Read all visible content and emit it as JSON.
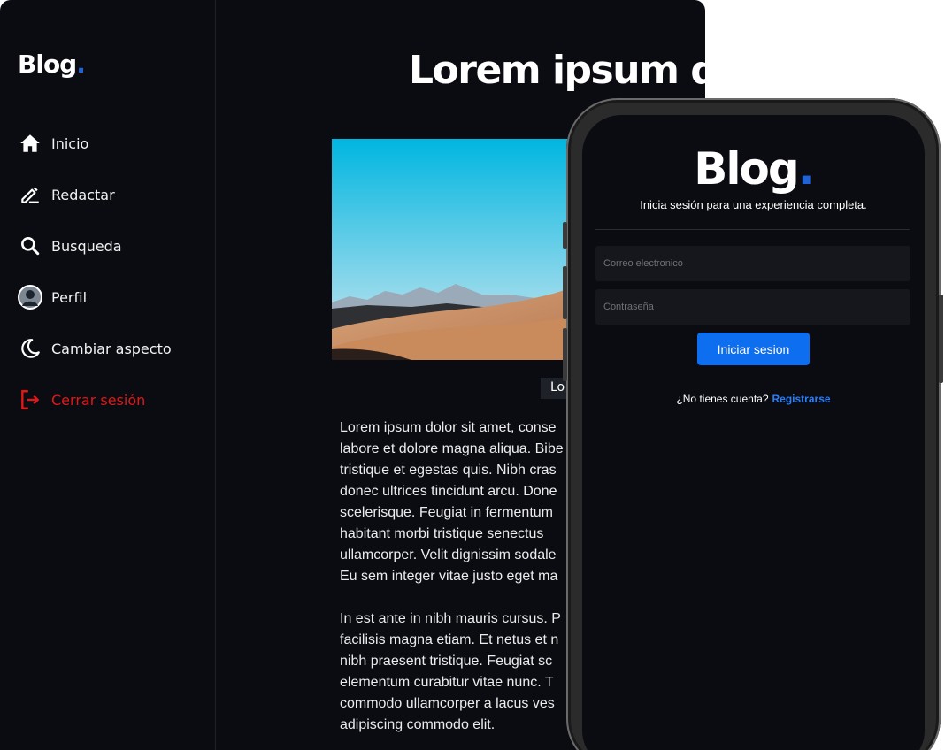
{
  "desktop": {
    "logo": {
      "text": "Blog",
      "dot": ".",
      "accent": "#1e63d8"
    },
    "sidebar": {
      "items": [
        {
          "label": "Inicio",
          "icon": "home-icon"
        },
        {
          "label": "Redactar",
          "icon": "edit-icon"
        },
        {
          "label": "Busqueda",
          "icon": "search-icon"
        },
        {
          "label": "Perfil",
          "icon": "avatar-icon"
        },
        {
          "label": "Cambiar aspecto",
          "icon": "moon-icon"
        },
        {
          "label": "Cerrar sesión",
          "icon": "logout-icon",
          "color": "#e01818"
        }
      ]
    },
    "post": {
      "title": "Lorem ipsum do",
      "caption": "Lo",
      "paragraph1": [
        "Lorem ipsum dolor sit amet, conse",
        "labore et dolore magna aliqua. Bibe",
        "tristique et egestas quis. Nibh cras",
        "donec ultrices tincidunt arcu. Done",
        "scelerisque. Feugiat in fermentum",
        "habitant morbi tristique senectus",
        "ullamcorper. Velit dignissim sodale",
        "Eu sem integer vitae justo eget ma"
      ],
      "paragraph2": [
        "In est ante in nibh mauris cursus. P",
        "facilisis magna etiam. Et netus et n",
        "nibh praesent tristique. Feugiat sc",
        "elementum curabitur vitae nunc. T",
        "commodo ullamcorper a lacus ves",
        "adipiscing commodo elit."
      ]
    }
  },
  "mobile": {
    "logo": {
      "text": "Blog",
      "dot": "."
    },
    "subtitle": "Inicia sesión para una experiencia completa.",
    "email_placeholder": "Correo electronico",
    "password_placeholder": "Contraseña",
    "login_label": "Iniciar sesion",
    "signup_prompt": "¿No tienes cuenta?",
    "signup_link": "Registrarse",
    "accent": "#0d6ef0"
  }
}
